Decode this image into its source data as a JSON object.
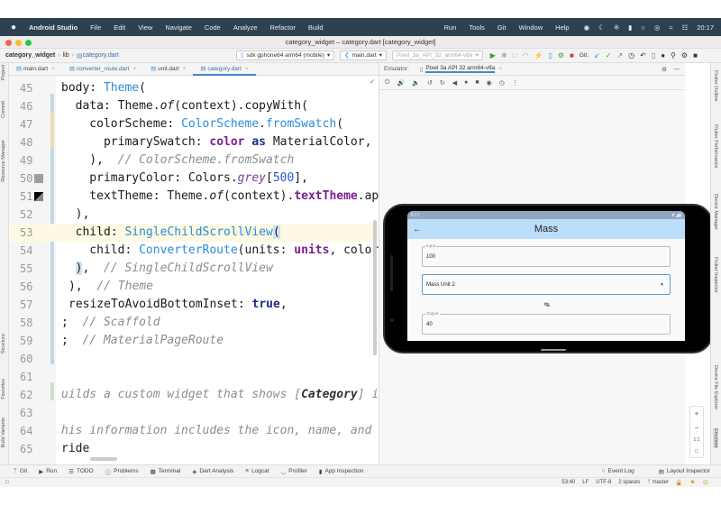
{
  "menubar": {
    "apple": "",
    "app": "Android Studio",
    "items": [
      "File",
      "Edit",
      "View",
      "Navigate",
      "Code",
      "Analyze",
      "Refactor",
      "Build",
      "Run",
      "Tools",
      "Git",
      "Window",
      "Help"
    ],
    "time": "20:17"
  },
  "window": {
    "title": "category_widget – category.dart [category_widget]"
  },
  "navbar": {
    "project": "category_widget",
    "folder": "lib",
    "file": "category.dart",
    "device": "sdk gphone64 arm64 (mobile)",
    "run_config": "main.dart",
    "avd": "Pixel_3a_API_32_arm64-v8a",
    "git_label": "Git:"
  },
  "editor": {
    "tabs": [
      {
        "label": "main.dart",
        "active": false
      },
      {
        "label": "converter_route.dart",
        "active": false
      },
      {
        "label": "unit.dart",
        "active": false
      },
      {
        "label": "category.dart",
        "active": true
      }
    ],
    "lines": [
      {
        "n": "45"
      },
      {
        "n": "46"
      },
      {
        "n": "47"
      },
      {
        "n": "48"
      },
      {
        "n": "49"
      },
      {
        "n": "50"
      },
      {
        "n": "51"
      },
      {
        "n": "52"
      },
      {
        "n": "53"
      },
      {
        "n": "54"
      },
      {
        "n": "55"
      },
      {
        "n": "56"
      },
      {
        "n": "57"
      },
      {
        "n": "58"
      },
      {
        "n": "59"
      },
      {
        "n": "60"
      },
      {
        "n": "61"
      },
      {
        "n": "62"
      },
      {
        "n": "63"
      },
      {
        "n": "64"
      },
      {
        "n": "65"
      }
    ],
    "code": {
      "l45a": "body: ",
      "l45b": "Theme",
      "l45c": "(",
      "l46a": "  data: Theme.",
      "l46b": "of",
      "l46c": "(context).copyWith(",
      "l47a": "    colorScheme: ",
      "l47b": "ColorScheme",
      "l47c": ".",
      "l47d": "fromSwatch",
      "l47e": "(",
      "l48a": "      primarySwatch: ",
      "l48b": "color",
      "l48c": " ",
      "l48d": "as",
      "l48e": " MaterialColor,",
      "l49a": "    ),  ",
      "l49b": "// ColorScheme.fromSwatch",
      "l50a": "    primaryColor: Colors.",
      "l50b": "grey",
      "l50c": "[",
      "l50d": "500",
      "l50e": "],",
      "l51a": "    textTheme: Theme.",
      "l51b": "of",
      "l51c": "(context).",
      "l51d": "textTheme",
      "l51e": ".appl",
      "l52a": "  ),",
      "l53a": "  child: ",
      "l53b": "SingleChildScrollView",
      "l53c": "(",
      "l54a": "    child: ",
      "l54b": "ConverterRoute",
      "l54c": "(units: ",
      "l54d": "units",
      "l54e": ", color",
      "l55a": "  ",
      "l55b": ")",
      "l55c": ",  ",
      "l55d": "// SingleChildScrollView",
      "l56a": "),  ",
      "l56b": "// Theme",
      "l57a": "resizeToAvoidBottomInset: ",
      "l57b": "true",
      "l57c": ",",
      "l58a": ";  ",
      "l58b": "// Scaffold",
      "l59a": ";  ",
      "l59b": "// MaterialPageRoute",
      "l62a": "uilds a custom widget that shows [",
      "l62b": "Category",
      "l62c": "] info",
      "l64a": "his information includes the icon, name, and col",
      "l65a": "ride"
    }
  },
  "left_tools": [
    "Project",
    "Commit",
    "Resource Manager",
    "Structure",
    "Favorites",
    "Build Variants"
  ],
  "right_tools": [
    "Flutter Outline",
    "Flutter Performance",
    "Device Manager",
    "Flutter Inspector",
    "Device File Explorer",
    "Emulator"
  ],
  "emulator": {
    "label": "Emulator:",
    "device_tab": "Pixel 3a API 32 arm64-v8a",
    "app": {
      "status_time": "8:17",
      "title": "Mass",
      "input_label": "Input",
      "input_value": "100",
      "dropdown_value": "Mass Unit 2",
      "output_label": "Output",
      "output_value": "40"
    },
    "zoom_controls": [
      "+",
      "−",
      "1:1",
      "□"
    ]
  },
  "bottom_tools": [
    "Git",
    "Run",
    "TODO",
    "Problems",
    "Terminal",
    "Dart Analysis",
    "Logcat",
    "Profiler",
    "App Inspection"
  ],
  "bottom_right": [
    "Event Log",
    "Layout Inspector"
  ],
  "status": {
    "position": "53:40",
    "line_sep": "LF",
    "encoding": "UTF-8",
    "indent": "2 spaces",
    "branch": "master"
  }
}
